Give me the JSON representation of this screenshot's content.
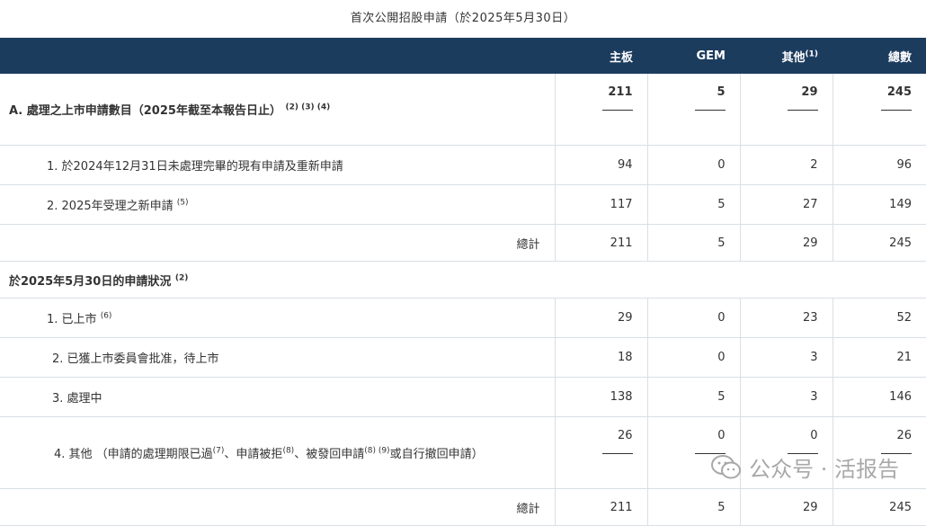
{
  "title": "首次公開招股申請（於2025年5月30日）",
  "header": {
    "col1": "主板",
    "col2": "GEM",
    "col3": "其他",
    "col3_sup": "(1)",
    "col4": "總數"
  },
  "section_a": {
    "label": "A. 處理之上市申請數目（2025年截至本報告日止）",
    "sup": "(2) (3) (4)",
    "values": [
      "211",
      "5",
      "29",
      "245"
    ]
  },
  "rows_a": [
    {
      "label": "1. 於2024年12月31日未處理完畢的現有申請及重新申請",
      "sup": "",
      "values": [
        "94",
        "0",
        "2",
        "96"
      ]
    },
    {
      "label": "2. 2025年受理之新申請",
      "sup": "(5)",
      "values": [
        "117",
        "5",
        "27",
        "149"
      ]
    }
  ],
  "total_a": {
    "label": "總計",
    "values": [
      "211",
      "5",
      "29",
      "245"
    ]
  },
  "section_b": {
    "label": "於2025年5月30日的申請狀況",
    "sup": "(2)"
  },
  "rows_b": [
    {
      "label": "1. 已上市",
      "sup": "(6)",
      "values": [
        "29",
        "0",
        "23",
        "52"
      ]
    },
    {
      "label": "2. 已獲上市委員會批准，待上市",
      "sup": "",
      "values": [
        "18",
        "0",
        "3",
        "21"
      ]
    },
    {
      "label": "3. 處理中",
      "sup": "",
      "values": [
        "138",
        "5",
        "3",
        "146"
      ]
    }
  ],
  "row_b4": {
    "label_a": "4. 其他 （申請的處理期限已過",
    "sup_a": "(7)",
    "label_b": "、申請被拒",
    "sup_b": "(8)",
    "label_c": "、被發回申請",
    "sup_c": "(8) (9)",
    "label_d": "或自行撤回申請）",
    "values": [
      "26",
      "0",
      "0",
      "26"
    ]
  },
  "total_b": {
    "label": "總計",
    "values": [
      "211",
      "5",
      "29",
      "245"
    ]
  },
  "watermark": "公众号 · 活报告"
}
